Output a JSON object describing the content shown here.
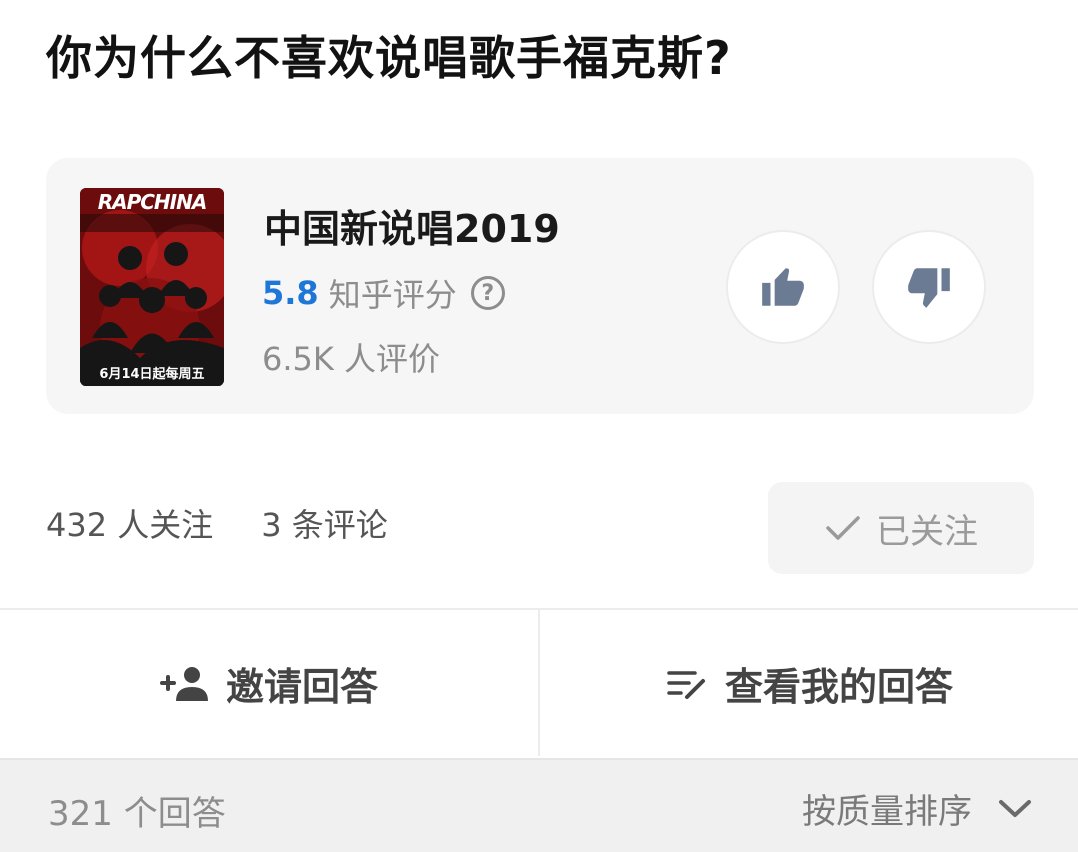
{
  "question": {
    "title": "你为什么不喜欢说唱歌手福克斯?"
  },
  "show": {
    "poster": {
      "brand_text": "RAPCHINA",
      "date_text": "6月14日起每周五"
    },
    "name": "中国新说唱2019",
    "score": "5.8",
    "score_label": "知乎评分",
    "help_symbol": "?",
    "review_count": "6.5K 人评价",
    "icons": {
      "upvote": "thumbs-up-icon",
      "downvote": "thumbs-down-icon"
    }
  },
  "stats": {
    "followers": "432 人关注",
    "comments": "3 条评论"
  },
  "follow_button": {
    "label": "已关注",
    "icon": "checkmark-icon"
  },
  "actions": {
    "invite": {
      "label": "邀请回答",
      "icon": "add-person-icon"
    },
    "my_answer": {
      "label": "查看我的回答",
      "icon": "edit-lines-icon"
    }
  },
  "footer": {
    "answers_count": "321 个回答",
    "sort_label": "按质量排序",
    "sort_icon": "chevron-down-icon"
  },
  "colors": {
    "score_blue": "#1e77d6",
    "vote_icon": "#6b7b93",
    "poster_red": "#7a0f0f"
  }
}
